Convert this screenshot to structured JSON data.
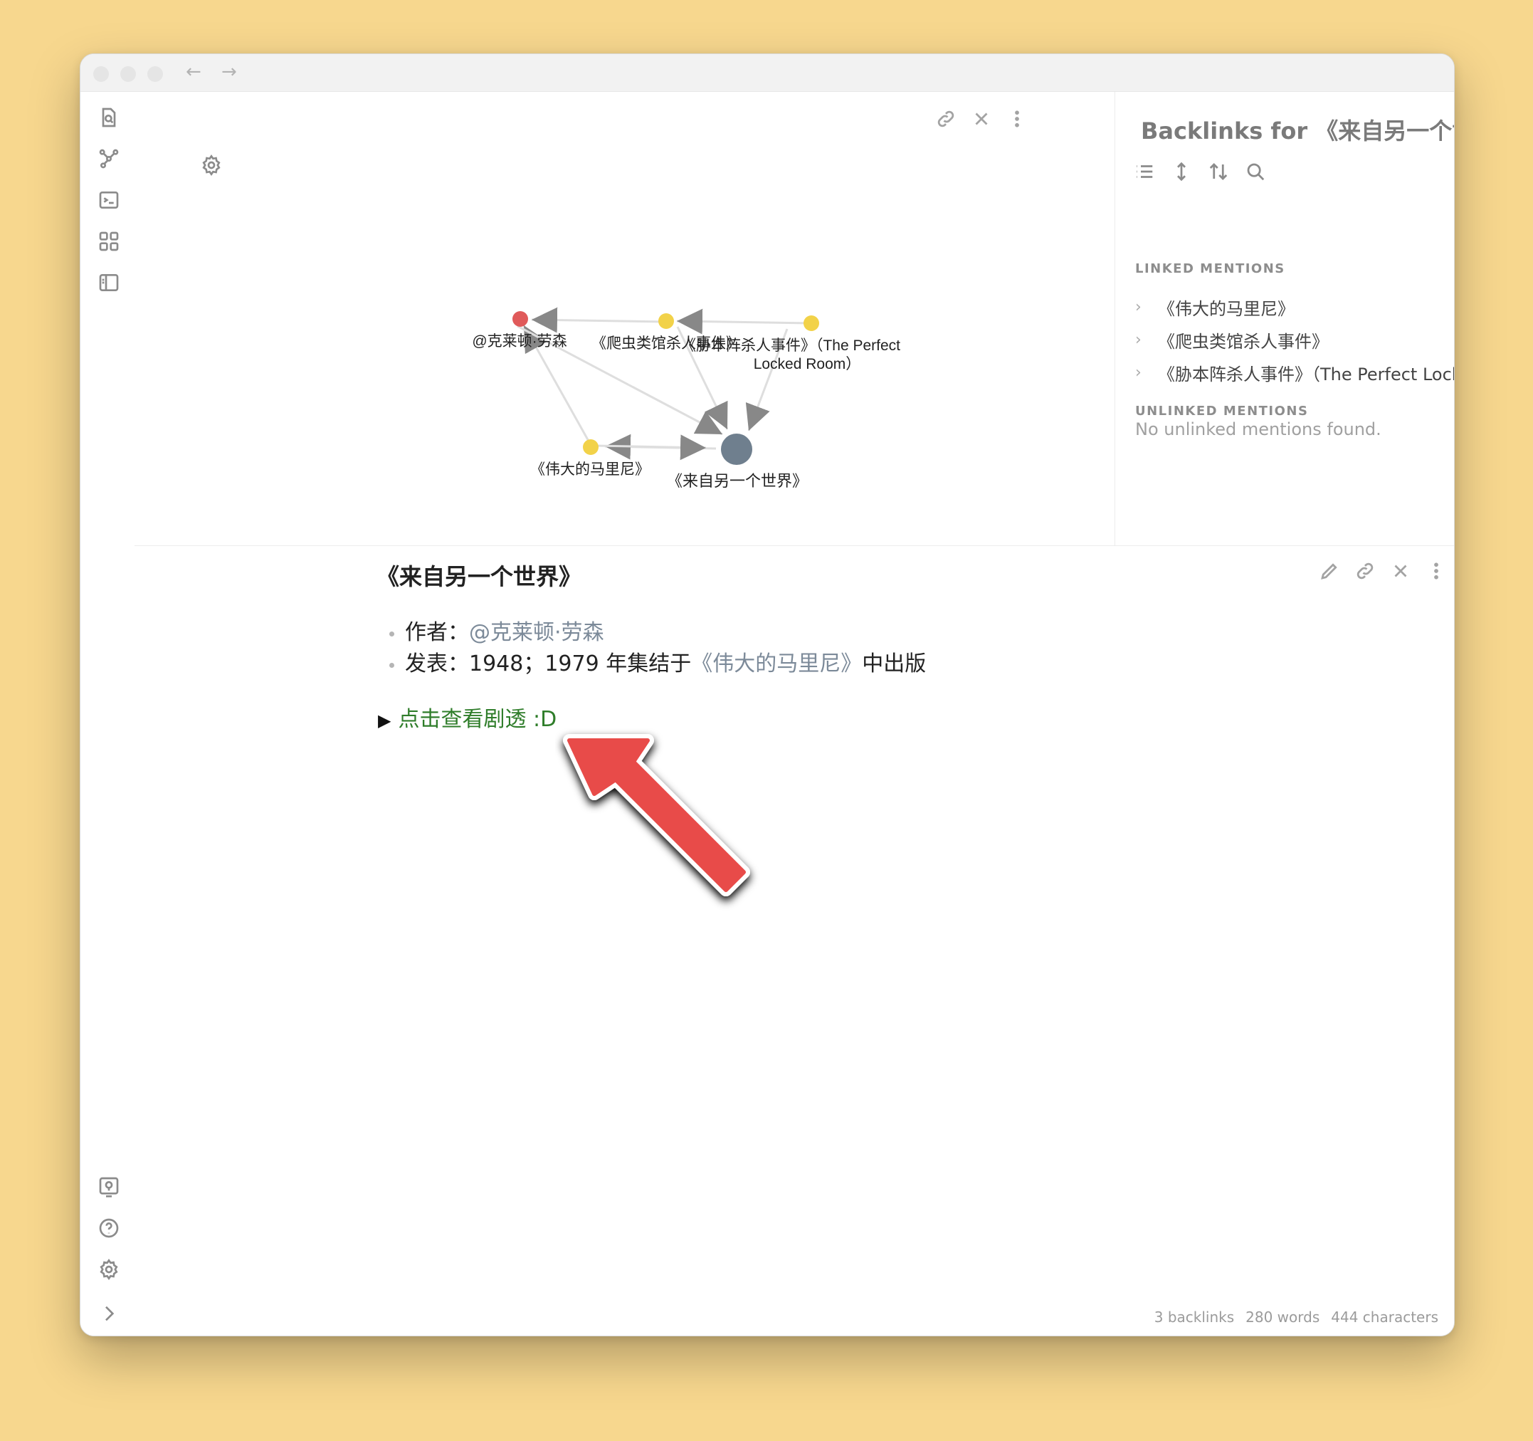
{
  "graph": {
    "nodes": [
      {
        "id": "author",
        "label": "@克莱顿·劳森",
        "color": "#e05a5a"
      },
      {
        "id": "reptile",
        "label": "《爬虫类馆杀人事件》",
        "color": "#f2d249"
      },
      {
        "id": "perfect",
        "label": "《胁本阵杀人事件》（The Perfect",
        "label2": "Locked Room）",
        "color": "#f2d249"
      },
      {
        "id": "marini",
        "label": "《伟大的马里尼》",
        "color": "#f2d249"
      },
      {
        "id": "other",
        "label": "《来自另一个世界》",
        "color": "#6f7f8e"
      }
    ]
  },
  "backlinks": {
    "title": "Backlinks for 《来自另一个世界",
    "linked_header": "LINKED MENTIONS",
    "linked": [
      "《伟大的马里尼》",
      "《爬虫类馆杀人事件》",
      "《胁本阵杀人事件》（The Perfect Locked Ro..."
    ],
    "unlinked_header": "UNLINKED MENTIONS",
    "unlinked_empty": "No unlinked mentions found."
  },
  "note": {
    "title": "《来自另一个世界》",
    "author_label": "作者：",
    "author_link": "@克莱顿·劳森",
    "pub_prefix": "发表：1948；1979 年集结于",
    "pub_link": "《伟大的马里尼》",
    "pub_suffix": "中出版",
    "spoiler": "点击查看剧透 :D"
  },
  "status": {
    "backlinks": "3 backlinks",
    "words": "280 words",
    "chars": "444 characters"
  },
  "colors": {
    "background": "#f7d78e",
    "annotation_arrow": "#e84c4a",
    "link": "#7c8a99",
    "spoiler": "#2f7d2a"
  }
}
